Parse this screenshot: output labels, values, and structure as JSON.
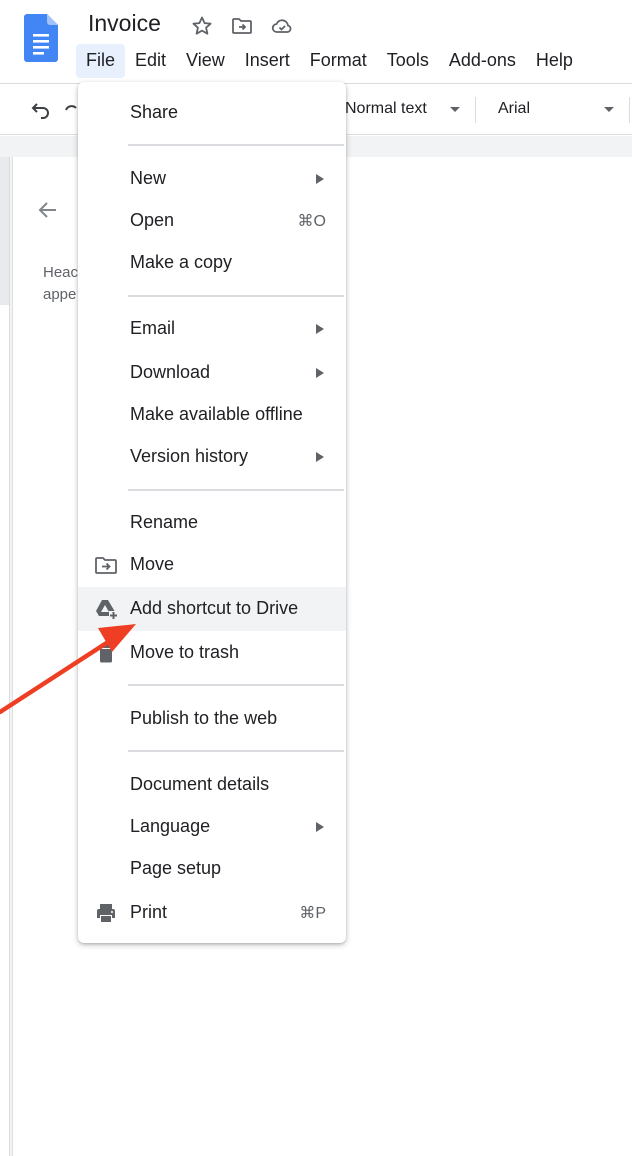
{
  "app": {
    "title": "Invoice",
    "brand_color": "#4285f4"
  },
  "menubar": {
    "items": [
      {
        "label": "File",
        "active": true
      },
      {
        "label": "Edit"
      },
      {
        "label": "View"
      },
      {
        "label": "Insert"
      },
      {
        "label": "Format"
      },
      {
        "label": "Tools"
      },
      {
        "label": "Add-ons"
      },
      {
        "label": "Help"
      }
    ]
  },
  "toolbar": {
    "style_label": "Normal text",
    "font_label": "Arial"
  },
  "outline": {
    "line1": "Heac",
    "line2": "appe"
  },
  "file_menu": {
    "share": "Share",
    "new": "New",
    "open": "Open",
    "open_shortcut": "⌘O",
    "make_copy": "Make a copy",
    "email": "Email",
    "download": "Download",
    "offline": "Make available offline",
    "version_history": "Version history",
    "rename": "Rename",
    "move": "Move",
    "add_shortcut": "Add shortcut to Drive",
    "trash": "Move to trash",
    "publish": "Publish to the web",
    "details": "Document details",
    "language": "Language",
    "page_setup": "Page setup",
    "print": "Print",
    "print_shortcut": "⌘P"
  },
  "icons": {
    "star": "star-icon",
    "move_to_folder": "folder-move-icon",
    "cloud": "cloud-saved-icon",
    "undo": "undo-icon",
    "drive_add": "drive-add-icon",
    "trash": "trash-icon",
    "print": "print-icon"
  },
  "colors": {
    "annotation_arrow": "#ee3f24",
    "menu_highlight": "#f1f3f4"
  }
}
